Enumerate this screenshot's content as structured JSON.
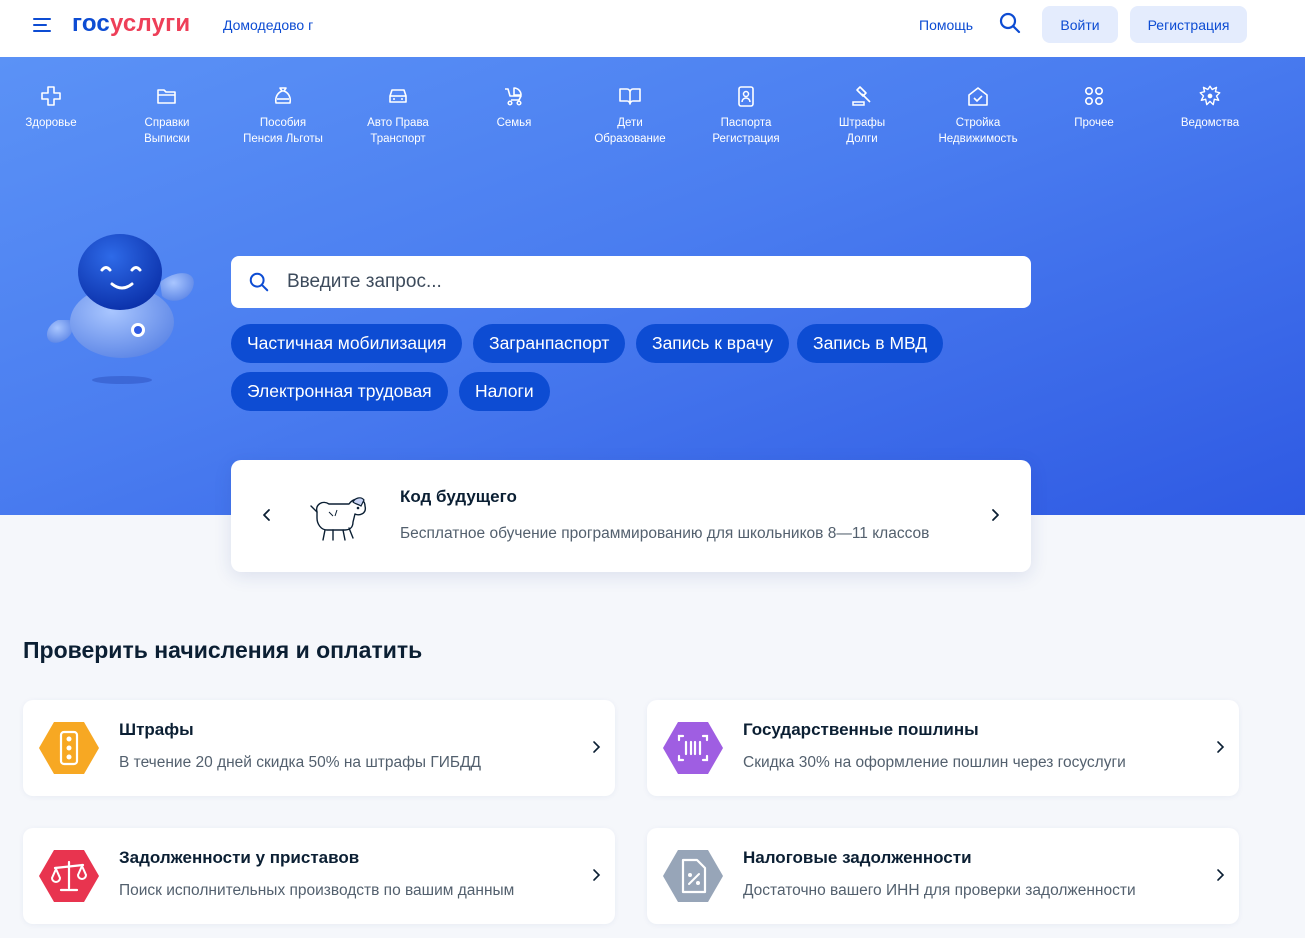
{
  "header": {
    "logo_part1": "гос",
    "logo_part2": "услуги",
    "city": "Домодедово г",
    "help": "Помощь",
    "login": "Войти",
    "register": "Регистрация"
  },
  "categories": [
    {
      "line1": "Здоровье",
      "line2": "",
      "icon": "health-cross-icon"
    },
    {
      "line1": "Справки",
      "line2": "Выписки",
      "icon": "folder-icon"
    },
    {
      "line1": "Пособия",
      "line2": "Пенсия Льготы",
      "icon": "money-bag-icon"
    },
    {
      "line1": "Авто Права",
      "line2": "Транспорт",
      "icon": "car-icon"
    },
    {
      "line1": "Семья",
      "line2": "",
      "icon": "stroller-icon"
    },
    {
      "line1": "Дети",
      "line2": "Образование",
      "icon": "book-icon"
    },
    {
      "line1": "Паспорта",
      "line2": "Регистрация",
      "icon": "passport-icon"
    },
    {
      "line1": "Штрафы",
      "line2": "Долги",
      "icon": "gavel-icon"
    },
    {
      "line1": "Стройка",
      "line2": "Недвижимость",
      "icon": "house-icon"
    },
    {
      "line1": "Прочее",
      "line2": "",
      "icon": "grid-icon"
    },
    {
      "line1": "Ведомства",
      "line2": "",
      "icon": "emblem-icon"
    }
  ],
  "search": {
    "placeholder": "Введите запрос..."
  },
  "chips": [
    "Частичная мобилизация",
    "Загранпаспорт",
    "Запись к врачу",
    "Запись в МВД",
    "Электронная трудовая",
    "Налоги"
  ],
  "promo": {
    "title": "Код будущего",
    "text": "Бесплатное обучение программированию для школьников 8—11 классов"
  },
  "payments": {
    "title": "Проверить начисления и оплатить",
    "cards": [
      {
        "title": "Штрафы",
        "text": "В течение 20 дней скидка 50% на штрафы ГИБДД",
        "color": "#f7a823",
        "icon": "traffic-light-icon"
      },
      {
        "title": "Государственные пошлины",
        "text": "Скидка 30% на оформление пошлин через госуслуги",
        "color": "#9f5ee2",
        "icon": "barcode-icon"
      },
      {
        "title": "Задолженности у приставов",
        "text": "Поиск исполнительных производств по вашим данным",
        "color": "#e8344f",
        "icon": "scales-icon"
      },
      {
        "title": "Налоговые задолженности",
        "text": "Достаточно вашего ИНН для проверки задолженности",
        "color": "#97a5b8",
        "icon": "tax-document-icon"
      }
    ]
  }
}
